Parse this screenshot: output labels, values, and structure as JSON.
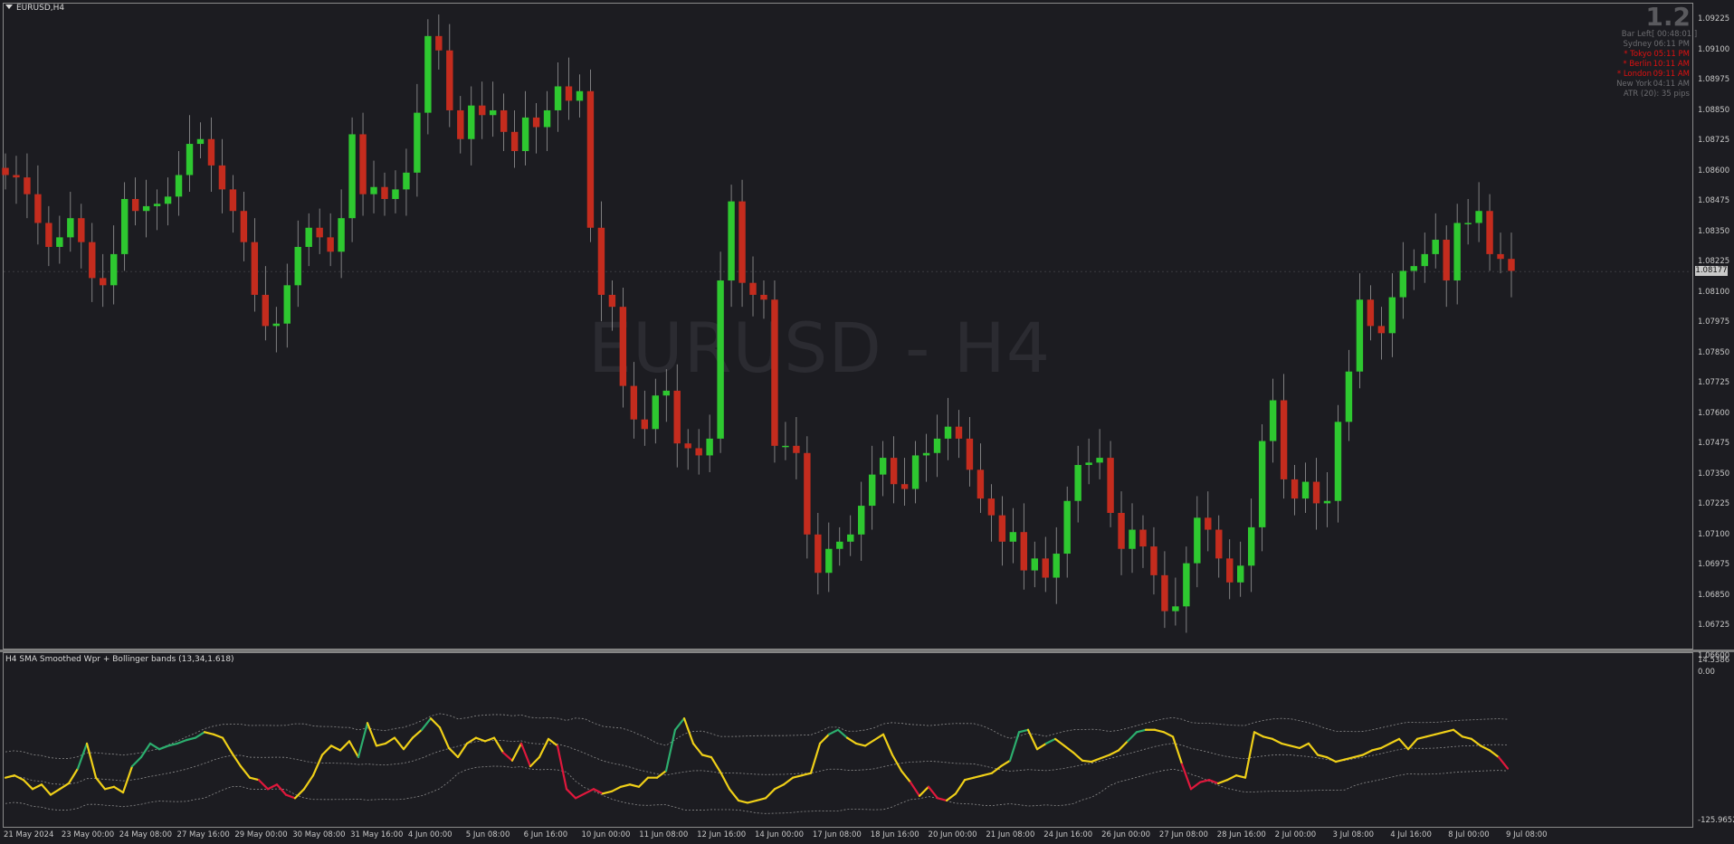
{
  "window": {
    "symbol_label": "EURUSD,H4",
    "watermark": "EURUSD - H4"
  },
  "info_panel": {
    "big_number": "1.2",
    "rows": [
      {
        "label": "Bar Left",
        "value": "[ 00:48:01 ]",
        "color": "#6c6c70"
      },
      {
        "label": "Sydney",
        "value": "06:11 PM",
        "color": "#6c6c70"
      },
      {
        "label": "* Tokyo",
        "value": "05:11 PM",
        "color": "#e01010"
      },
      {
        "label": "* Berlin",
        "value": "10:11 AM",
        "color": "#e01010"
      },
      {
        "label": "* London",
        "value": "09:11 AM",
        "color": "#e01010"
      },
      {
        "label": "New York",
        "value": "04:11 AM",
        "color": "#6c6c70"
      },
      {
        "label": "ATR (20): 35 pips",
        "value": "",
        "color": "#6c6c70"
      }
    ]
  },
  "price_axis": {
    "labels": [
      "1.09225",
      "1.09100",
      "1.08975",
      "1.08850",
      "1.08725",
      "1.08600",
      "1.08475",
      "1.08350",
      "1.08225",
      "1.08100",
      "1.07975",
      "1.07850",
      "1.07725",
      "1.07600",
      "1.07475",
      "1.07350",
      "1.07225",
      "1.07100",
      "1.06975",
      "1.06850",
      "1.06725",
      "1.06600"
    ],
    "current_price": "1.08177"
  },
  "indicator": {
    "title": "H4 SMA Smoothed Wpr + Bollinger bands (13,34,1.618)",
    "axis_labels": [
      "14.5386",
      "0.00",
      "-125.9652"
    ]
  },
  "time_axis": [
    "21 May 2024",
    "23 May 00:00",
    "24 May 08:00",
    "27 May 16:00",
    "29 May 00:00",
    "30 May 08:00",
    "31 May 16:00",
    "4 Jun 00:00",
    "5 Jun 08:00",
    "6 Jun 16:00",
    "10 Jun 00:00",
    "11 Jun 08:00",
    "12 Jun 16:00",
    "14 Jun 00:00",
    "17 Jun 08:00",
    "18 Jun 16:00",
    "20 Jun 00:00",
    "21 Jun 08:00",
    "24 Jun 16:00",
    "26 Jun 00:00",
    "27 Jun 08:00",
    "28 Jun 16:00",
    "2 Jul 00:00",
    "3 Jul 08:00",
    "4 Jul 16:00",
    "8 Jul 00:00",
    "9 Jul 08:00"
  ],
  "colors": {
    "bull": "#2ec830",
    "bear": "#c42c1e",
    "wpr": "#f0d018",
    "wpr_down": "#e0183c",
    "wpr_up": "#2cae6e",
    "bands": "#8c8c8c"
  },
  "chart_data": {
    "type": "candlestick",
    "timeframe": "H4",
    "ylim": [
      1.066,
      1.0925
    ],
    "candles_close_approx": [
      1.0858,
      1.0857,
      1.085,
      1.0838,
      1.0828,
      1.0832,
      1.084,
      1.083,
      1.0815,
      1.0812,
      1.0825,
      1.0848,
      1.0843,
      1.0845,
      1.0846,
      1.0849,
      1.0858,
      1.0871,
      1.0873,
      1.0862,
      1.0852,
      1.0843,
      1.083,
      1.0808,
      1.0795,
      1.0796,
      1.0812,
      1.0828,
      1.0836,
      1.0832,
      1.0826,
      1.084,
      1.0875,
      1.085,
      1.0853,
      1.0848,
      1.0852,
      1.0859,
      1.0884,
      1.0916,
      1.091,
      1.0885,
      1.0873,
      1.0887,
      1.0883,
      1.0885,
      1.0876,
      1.0868,
      1.0882,
      1.0878,
      1.0885,
      1.0895,
      1.0889,
      1.0893,
      1.0836,
      1.0808,
      1.0803,
      1.077,
      1.0756,
      1.0752,
      1.0766,
      1.0768,
      1.0746,
      1.0744,
      1.0741,
      1.0748,
      1.0814,
      1.0847,
      1.0813,
      1.0808,
      1.0806,
      1.0745,
      1.0745,
      1.0742,
      1.0708,
      1.0692,
      1.0702,
      1.0705,
      1.0708,
      1.072,
      1.0733,
      1.074,
      1.0729,
      1.0727,
      1.0741,
      1.0742,
      1.0748,
      1.0753,
      1.0748,
      1.0735,
      1.0723,
      1.0716,
      1.0705,
      1.0709,
      1.0693,
      1.0698,
      1.069,
      1.07,
      1.0722,
      1.0737,
      1.0738,
      1.074,
      1.0717,
      1.0702,
      1.071,
      1.0703,
      1.0691,
      1.0676,
      1.0678,
      1.0696,
      1.0715,
      1.071,
      1.0698,
      1.0688,
      1.0695,
      1.0711,
      1.0747,
      1.0764,
      1.0731,
      1.0723,
      1.073,
      1.0721,
      1.0722,
      1.0755,
      1.0776,
      1.0806,
      1.0795,
      1.0792,
      1.0807,
      1.0818,
      1.082,
      1.0825,
      1.0831,
      1.0814,
      1.0838,
      1.0838,
      1.0843,
      1.0825,
      1.0823,
      1.0818
    ]
  },
  "indicator_data": {
    "type": "line",
    "ylim": [
      -125.9652,
      14.5386
    ],
    "wpr_approx": [
      -90,
      -88,
      -92,
      -100,
      -96,
      -105,
      -100,
      -95,
      -82,
      -60,
      -90,
      -100,
      -98,
      -103,
      -80,
      -72,
      -60,
      -65,
      -62,
      -60,
      -57,
      -55,
      -50,
      -52,
      -55,
      -68,
      -80,
      -90,
      -92,
      -100,
      -96,
      -105,
      -108,
      -100,
      -88,
      -70,
      -62,
      -66,
      -58,
      -72,
      -42,
      -62,
      -60,
      -55,
      -65,
      -55,
      -48,
      -38,
      -46,
      -64,
      -72,
      -60,
      -55,
      -58,
      -55,
      -68,
      -75,
      -60,
      -80,
      -72,
      -56,
      -62,
      -100,
      -108,
      -104,
      -100,
      -104,
      -102,
      -98,
      -96,
      -98,
      -90,
      -90,
      -84,
      -48,
      -38,
      -60,
      -70,
      -72,
      -85,
      -100,
      -110,
      -112,
      -110,
      -108,
      -100,
      -96,
      -90,
      -88,
      -86,
      -60,
      -52,
      -48,
      -55,
      -60,
      -62,
      -57,
      -52,
      -70,
      -84,
      -94,
      -106,
      -98,
      -108,
      -110,
      -104,
      -92,
      -90,
      -88,
      -86,
      -80,
      -75,
      -50,
      -48,
      -65,
      -60,
      -56,
      -62,
      -68,
      -75,
      -76,
      -73,
      -70,
      -66,
      -58,
      -50,
      -48,
      -48,
      -50,
      -54,
      -78,
      -100,
      -94,
      -92,
      -95,
      -92,
      -88,
      -90,
      -50,
      -54,
      -56,
      -60,
      -62,
      -64,
      -60,
      -70,
      -72,
      -76,
      -74,
      -72,
      -70,
      -66,
      -64,
      -60,
      -56,
      -65,
      -56,
      -54,
      -52,
      -50,
      -48,
      -54,
      -56,
      -62,
      -66,
      -72,
      -82
    ]
  }
}
